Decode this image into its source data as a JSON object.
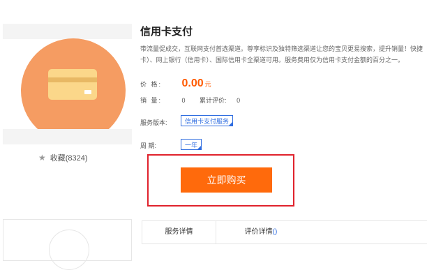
{
  "product": {
    "title": "信用卡支付",
    "description_line1": "带流量促成交，互联网支付首选渠道。尊享标识及独特筛选渠道让您的宝贝更易搜索，提升销量！快捷",
    "description_line2": "卡）、网上银行（信用卡）、国际信用卡全渠道可用。服务费用仅为信用卡支付金额的百分之一。"
  },
  "favorite": {
    "label": "收藏(8324)",
    "icon": "star-icon"
  },
  "fields": {
    "price_label": "价    格:",
    "price_value": "0.00",
    "price_unit": "元",
    "sales_label": "销    量:",
    "sales_value": "0",
    "reviews_label": "累计评价:",
    "reviews_value": "0",
    "version_label": "服务版本:",
    "version_option": "信用卡支付服务",
    "period_label": "周    期:",
    "period_option": "一年"
  },
  "buy_button": {
    "label": "立即购买"
  },
  "tabs": [
    {
      "label": "服务详情"
    },
    {
      "label": "评价详情",
      "count": "()"
    }
  ],
  "colors": {
    "accent": "#ff6a0c",
    "price": "#ff5a00",
    "link": "#2f6de0",
    "highlight_box": "#e0222c",
    "icon_bg": "#f59c62"
  }
}
